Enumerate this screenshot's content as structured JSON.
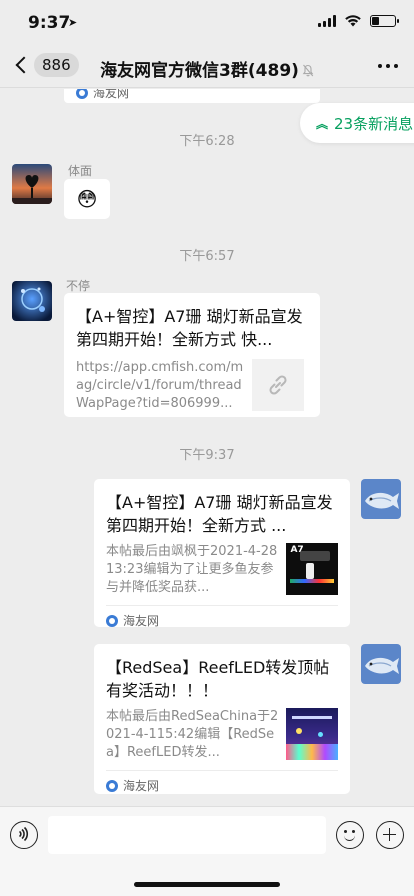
{
  "status": {
    "time": "9:37",
    "battery_level": 0.3
  },
  "nav": {
    "back_count": "886",
    "title": "海友网官方微信3群(489)"
  },
  "new_messages": "23条新消息",
  "top_card_source": "海友网",
  "time_separators": [
    "下午6:28",
    "下午6:57",
    "下午9:37"
  ],
  "messages": [
    {
      "sender": "体面",
      "emoji": "😳"
    },
    {
      "sender": "不停",
      "title": "【A+智控】A7珊 瑚灯新品宣发 第四期开始！全新方式 快...",
      "url": "https://app.cmfish.com/mag/circle/v1/forum/threadWapPage?tid=806999..."
    }
  ],
  "cards": [
    {
      "title": "【A+智控】A7珊 瑚灯新品宣发  第四期开始！全新方式 ...",
      "desc": "本帖最后由飒枫于2021-4-2813:23编辑为了让更多鱼友参与并降低奖品获...",
      "thumb_label": "A7",
      "source": "海友网"
    },
    {
      "title": "【RedSea】ReefLED转发顶帖有奖活动！！！",
      "desc": "本帖最后由RedSeaChina于2021-4-115:42编辑【RedSea】ReefLED转发...",
      "source": "海友网"
    }
  ],
  "input_bar": {
    "placeholder": ""
  },
  "colors": {
    "accent_green": "#07a05f",
    "background": "#ededed"
  }
}
